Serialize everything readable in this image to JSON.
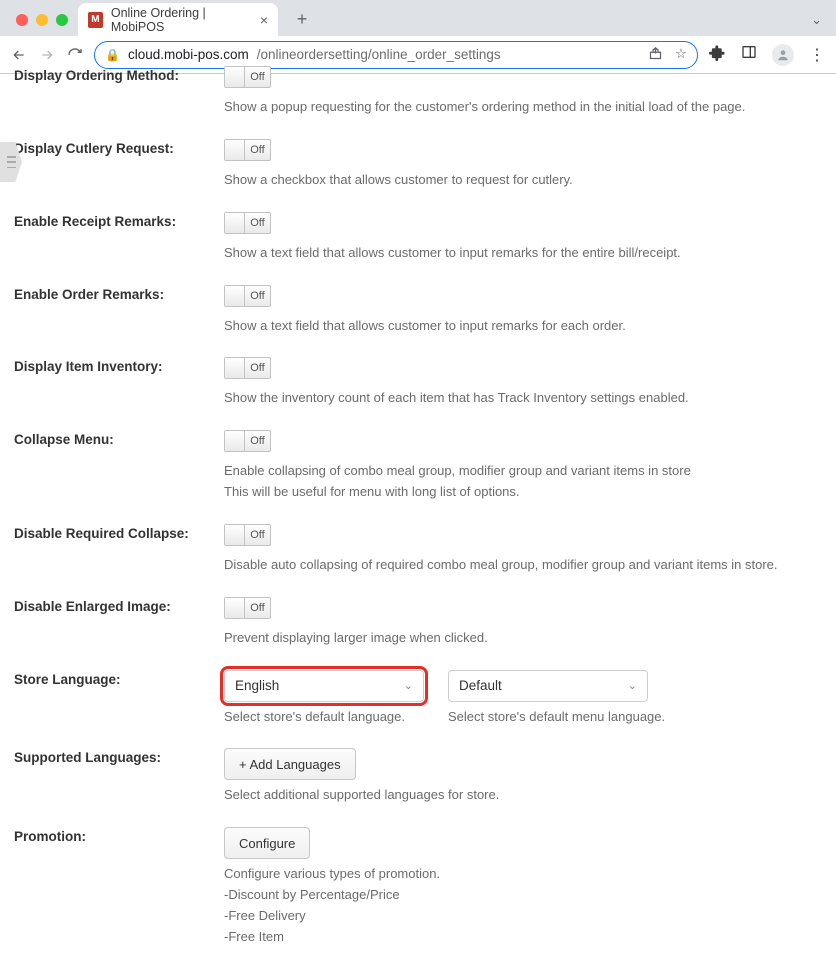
{
  "browser": {
    "tab_title": "Online Ordering | MobiPOS",
    "url_host": "cloud.mobi-pos.com",
    "url_path": "/onlineordersetting/online_order_settings"
  },
  "settings": [
    {
      "key": "ordering_method",
      "label": "Display Ordering Method:",
      "toggle": "Off",
      "desc": [
        "Show a popup requesting for the customer's ordering method in the initial load of the page."
      ]
    },
    {
      "key": "cutlery",
      "label": "Display Cutlery Request:",
      "toggle": "Off",
      "desc": [
        "Show a checkbox that allows customer to request for cutlery."
      ]
    },
    {
      "key": "receipt_remarks",
      "label": "Enable Receipt Remarks:",
      "toggle": "Off",
      "desc": [
        "Show a text field that allows customer to input remarks for the entire bill/receipt."
      ]
    },
    {
      "key": "order_remarks",
      "label": "Enable Order Remarks:",
      "toggle": "Off",
      "desc": [
        "Show a text field that allows customer to input remarks for each order."
      ]
    },
    {
      "key": "item_inventory",
      "label": "Display Item Inventory:",
      "toggle": "Off",
      "desc": [
        "Show the inventory count of each item that has Track Inventory settings enabled."
      ]
    },
    {
      "key": "collapse_menu",
      "label": "Collapse Menu:",
      "toggle": "Off",
      "desc": [
        "Enable collapsing of combo meal group, modifier group and variant items in store",
        "This will be useful for menu with long list of options."
      ]
    },
    {
      "key": "disable_collapse",
      "label": "Disable Required Collapse:",
      "toggle": "Off",
      "desc": [
        "Disable auto collapsing of required combo meal group, modifier group and variant items in store."
      ]
    },
    {
      "key": "disable_enlarged",
      "label": "Disable Enlarged Image:",
      "toggle": "Off",
      "desc": [
        "Prevent displaying larger image when clicked."
      ]
    }
  ],
  "language": {
    "label": "Store Language:",
    "value": "English",
    "desc": "Select store's default language.",
    "menu_value": "Default",
    "menu_desc": "Select store's default menu language."
  },
  "supported": {
    "label": "Supported Languages:",
    "button": "+ Add Languages",
    "desc": "Select additional supported languages for store."
  },
  "promotion": {
    "label": "Promotion:",
    "button": "Configure",
    "desc": [
      "Configure various types of promotion.",
      "-Discount by Percentage/Price",
      "-Free Delivery",
      "-Free Item"
    ]
  }
}
